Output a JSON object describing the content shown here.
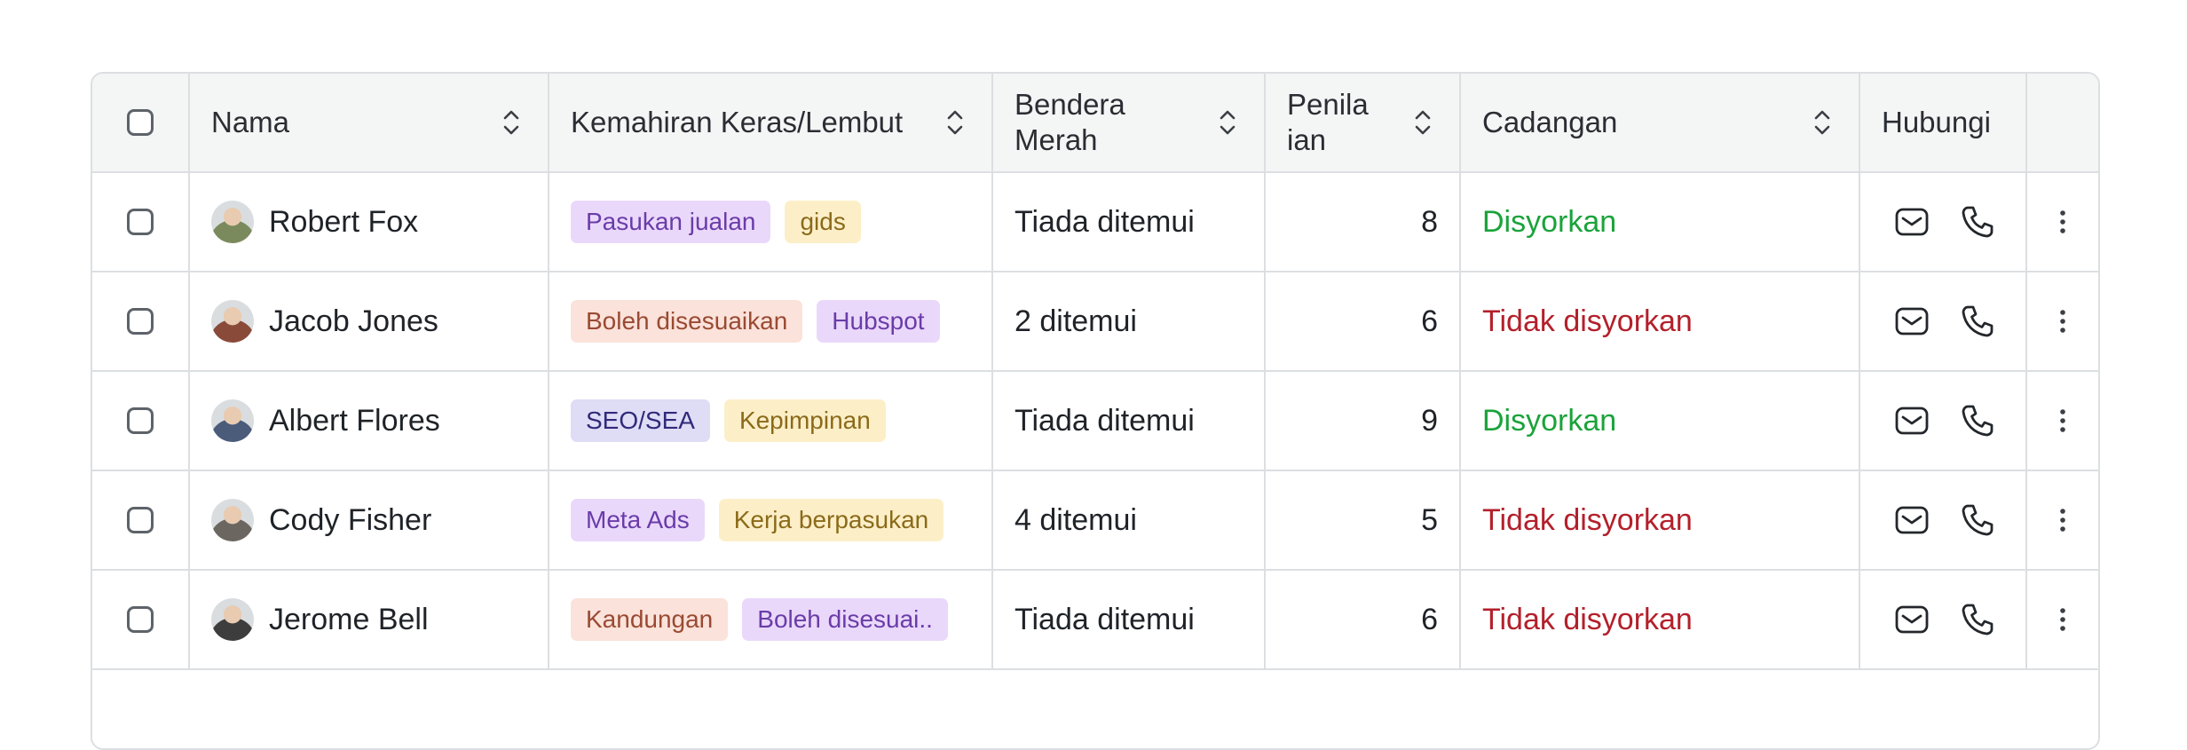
{
  "columns": {
    "name": "Nama",
    "skills": "Kemahiran Keras/Lembut",
    "red_flag_line1": "Bendera",
    "red_flag_line2": "Merah",
    "rating_line1": "Penila",
    "rating_line2": "ian",
    "recommendation": "Cadangan",
    "contact": "Hubungi"
  },
  "rows": [
    {
      "name": "Robert Fox",
      "avatar_color": "#7b8a5c",
      "tags": [
        {
          "label": "Pasukan jualan",
          "style": "purple"
        },
        {
          "label": "gids",
          "style": "yellow"
        }
      ],
      "red_flag": "Tiada ditemui",
      "rating": "8",
      "recommendation": "Disyorkan",
      "rec_status": "ok"
    },
    {
      "name": "Jacob Jones",
      "avatar_color": "#8a4a3a",
      "tags": [
        {
          "label": "Boleh disesuaikan",
          "style": "peach"
        },
        {
          "label": "Hubspot",
          "style": "purple"
        }
      ],
      "red_flag": "2 ditemui",
      "rating": "6",
      "recommendation": "Tidak disyorkan",
      "rec_status": "no"
    },
    {
      "name": "Albert Flores",
      "avatar_color": "#4a5c7a",
      "tags": [
        {
          "label": "SEO/SEA",
          "style": "indigo"
        },
        {
          "label": "Kepimpinan",
          "style": "yellow"
        }
      ],
      "red_flag": "Tiada ditemui",
      "rating": "9",
      "recommendation": "Disyorkan",
      "rec_status": "ok"
    },
    {
      "name": "Cody Fisher",
      "avatar_color": "#6b6660",
      "tags": [
        {
          "label": "Meta Ads",
          "style": "purple"
        },
        {
          "label": "Kerja berpasukan",
          "style": "yellow"
        }
      ],
      "red_flag": "4 ditemui",
      "rating": "5",
      "recommendation": "Tidak disyorkan",
      "rec_status": "no"
    },
    {
      "name": "Jerome Bell",
      "avatar_color": "#3d3d3d",
      "tags": [
        {
          "label": "Kandungan",
          "style": "peach"
        },
        {
          "label": "Boleh disesuai..",
          "style": "purple"
        }
      ],
      "red_flag": "Tiada ditemui",
      "rating": "6",
      "recommendation": "Tidak disyorkan",
      "rec_status": "no"
    }
  ],
  "colors": {
    "recommended": "#1aa33a",
    "not_recommended": "#b3202b",
    "border": "#dcdfe1",
    "header_bg": "#f4f5f5"
  }
}
